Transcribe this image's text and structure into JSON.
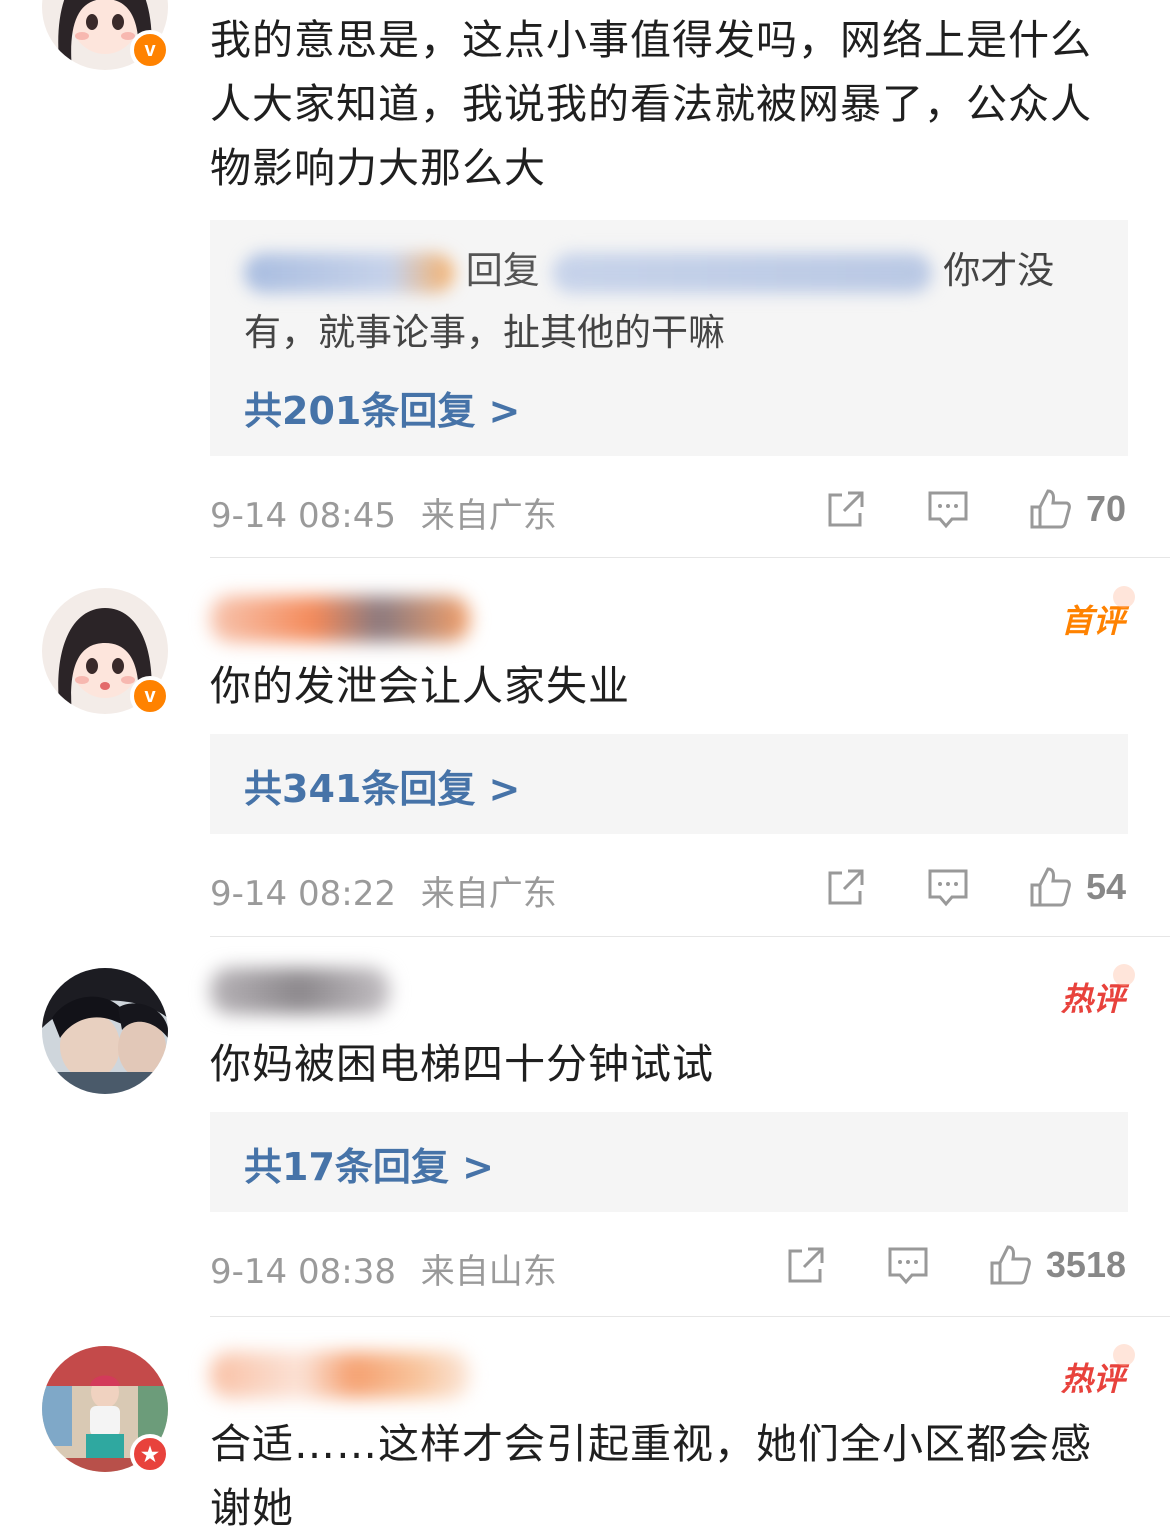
{
  "comments": [
    {
      "text": "我的意思是，这点小事值得发吗，网络上是什么人大家知道，我说我的看法就被网暴了，公众人物影响力大那么大",
      "reply_preview": {
        "mid": "回复",
        "text": "你才没有，就事论事，扯其他的干嘛"
      },
      "reply_count": "共201条回复 >",
      "time": "9-14 08:45",
      "location": "来自广东",
      "likes": "70"
    },
    {
      "tag": "首评",
      "text": "你的发泄会让人家失业",
      "reply_count": "共341条回复 >",
      "time": "9-14 08:22",
      "location": "来自广东",
      "likes": "54"
    },
    {
      "tag": "热评",
      "text": "你妈被困电梯四十分钟试试",
      "reply_count": "共17条回复 >",
      "time": "9-14 08:38",
      "location": "来自山东",
      "likes": "3518"
    },
    {
      "tag": "热评",
      "text": "合适……这样才会引起重视，她们全小区都会感谢她"
    }
  ],
  "icons": {
    "badge_verified": "v",
    "badge_star": "★"
  },
  "colors": {
    "link_blue": "#4673a8",
    "tag_orange": "#ff8200",
    "tag_red": "#e8423c",
    "meta_gray": "#9a9a9a"
  }
}
